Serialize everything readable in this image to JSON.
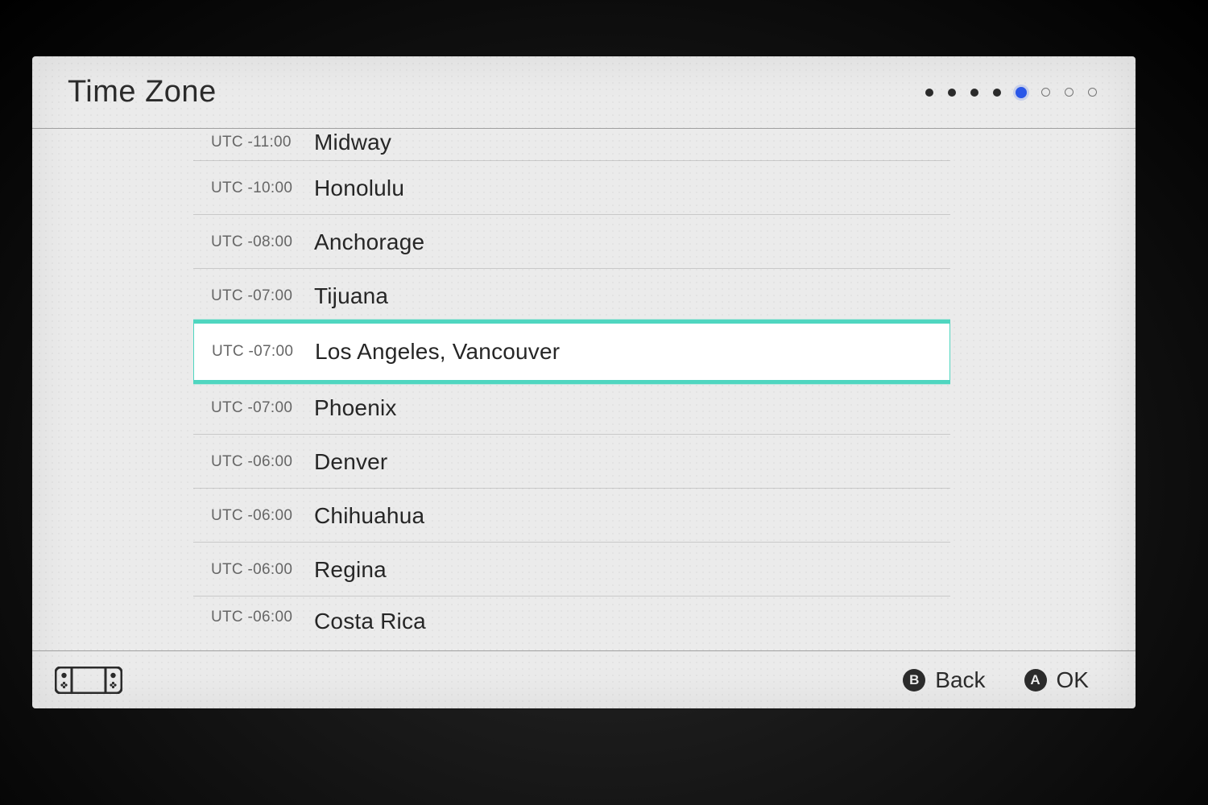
{
  "header": {
    "title": "Time Zone",
    "pager": {
      "filled": 4,
      "active_index": 4,
      "future": 3
    }
  },
  "timezones": [
    {
      "offset": "UTC -11:00",
      "city": "Midway",
      "cut": "top"
    },
    {
      "offset": "UTC -10:00",
      "city": "Honolulu"
    },
    {
      "offset": "UTC -08:00",
      "city": "Anchorage"
    },
    {
      "offset": "UTC -07:00",
      "city": "Tijuana"
    },
    {
      "offset": "UTC -07:00",
      "city": "Los Angeles, Vancouver",
      "selected": true
    },
    {
      "offset": "UTC -07:00",
      "city": "Phoenix"
    },
    {
      "offset": "UTC -06:00",
      "city": "Denver"
    },
    {
      "offset": "UTC -06:00",
      "city": "Chihuahua"
    },
    {
      "offset": "UTC -06:00",
      "city": "Regina"
    },
    {
      "offset": "UTC -06:00",
      "city": "Costa Rica",
      "cut": "bot"
    }
  ],
  "footer": {
    "back": {
      "key": "B",
      "label": "Back"
    },
    "ok": {
      "key": "A",
      "label": "OK"
    }
  }
}
